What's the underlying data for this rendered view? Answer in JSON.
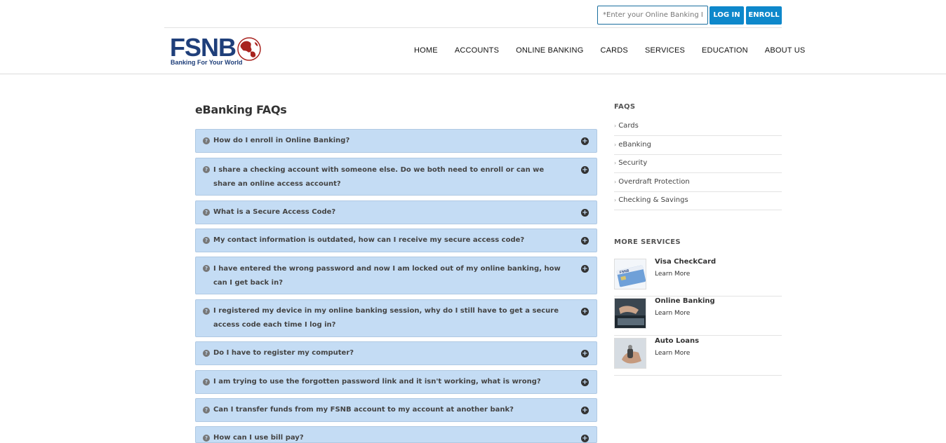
{
  "top": {
    "login_placeholder": "*Enter your Online Banking ID",
    "login_button": "LOG IN",
    "enroll_button": "ENROLL"
  },
  "logo": {
    "name": "FSNB",
    "tagline": "Banking For Your World"
  },
  "nav": [
    "HOME",
    "ACCOUNTS",
    "ONLINE BANKING",
    "CARDS",
    "SERVICES",
    "EDUCATION",
    "ABOUT US"
  ],
  "main": {
    "title": "eBanking FAQs",
    "faqs": [
      "How do I enroll in Online Banking?",
      "I share a checking account with someone else. Do we both need to enroll or can we share an online access account?",
      "What is a Secure Access Code?",
      "My contact information is outdated, how can I receive my secure access code?",
      "I have entered the wrong password and now I am locked out of my online banking, how can I get back in?",
      "I registered my device in my online banking session, why do I still have to get a secure access code each time I log in?",
      "Do I have to register my computer?",
      "I am trying to use the forgotten password link and it isn't working, what is wrong?",
      "Can I transfer funds from my FSNB account to my account at another bank?",
      "How can I use bill pay?"
    ]
  },
  "sidebar": {
    "faqs_heading": "FAQS",
    "faq_links": [
      "Cards",
      "eBanking",
      "Security",
      "Overdraft Protection",
      "Checking & Savings"
    ],
    "services_heading": "MORE SERVICES",
    "services": [
      {
        "name": "Visa CheckCard",
        "link": "Learn More"
      },
      {
        "name": "Online Banking",
        "link": "Learn More"
      },
      {
        "name": "Auto Loans",
        "link": "Learn More"
      }
    ]
  },
  "colors": {
    "accent": "#0e88cb",
    "faq_bg": "#c4dcf4",
    "brand_navy": "#1f3f7a",
    "brand_red": "#a8231f"
  }
}
